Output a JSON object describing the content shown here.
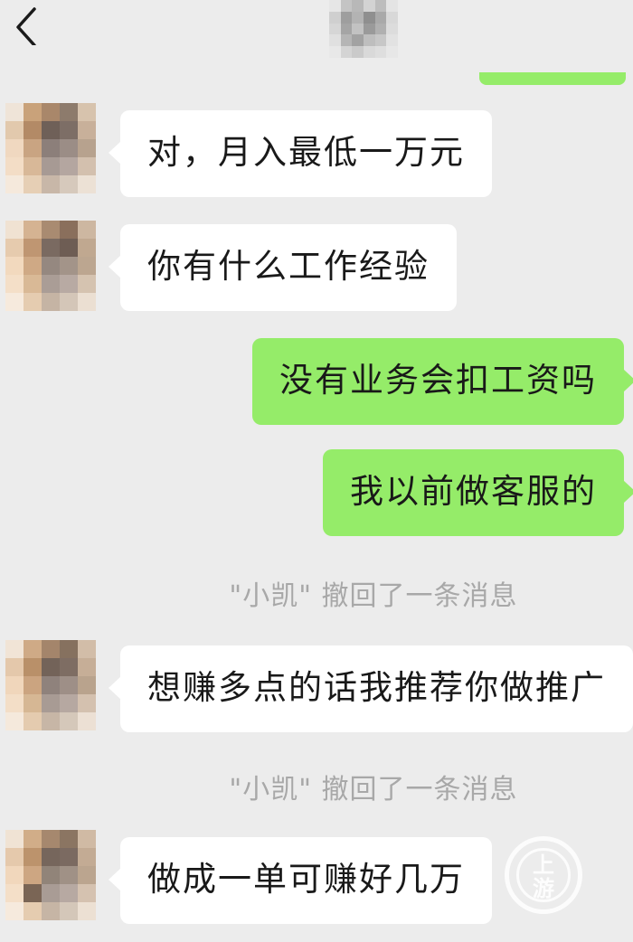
{
  "header": {
    "contact_name": "小凯"
  },
  "messages": [
    {
      "side": "in",
      "text": "对，月入最低一万元"
    },
    {
      "side": "in",
      "text": "你有什么工作经验"
    },
    {
      "side": "out",
      "text": "没有业务会扣工资吗"
    },
    {
      "side": "out",
      "text": "我以前做客服的"
    },
    {
      "side": "system",
      "text": "\"小凯\" 撤回了一条消息"
    },
    {
      "side": "in",
      "text": "想赚多点的话我推荐你做推广"
    },
    {
      "side": "system",
      "text": "\"小凯\" 撤回了一条消息"
    },
    {
      "side": "in",
      "text": "做成一单可赚好几万"
    }
  ],
  "watermark": {
    "text": "上游"
  },
  "colors": {
    "background": "#ececec",
    "incoming_bubble": "#ffffff",
    "outgoing_bubble": "#95ec69",
    "system_text": "#a8a8a8"
  },
  "icons": {
    "back": "chevron-left-icon"
  }
}
